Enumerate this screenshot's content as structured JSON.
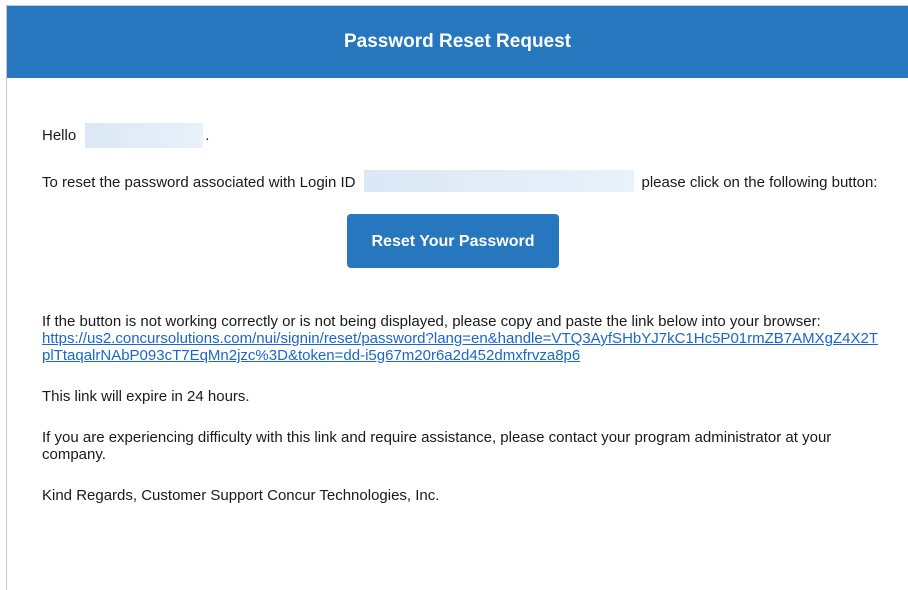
{
  "header": {
    "title": "Password Reset Request"
  },
  "email": {
    "greeting": "Hello",
    "greeting_suffix": ".",
    "reset_prefix": "To reset the password associated with Login ID",
    "reset_suffix": "please click on the following button:",
    "reset_button_label": "Reset Your Password",
    "fallback_text": "If the button is not working correctly or is not being displayed, please copy and paste the link below into your browser:",
    "reset_link": "https://us2.concursolutions.com/nui/signin/reset/password?lang=en&handle=VTQ3AyfSHbYJ7kC1Hc5P01rmZB7AMXgZ4X2TplTtaqalrNAbP093cT7EqMn2jzc%3D&token=dd-i5g67m20r6a2d452dmxfrvza8p6",
    "expiry_text": "This link will expire in 24 hours.",
    "help_text": "If you are experiencing difficulty with this link and require assistance, please contact your program administrator at your company.",
    "signoff": "Kind Regards, Customer Support Concur Technologies, Inc."
  },
  "colors": {
    "brand_blue": "#2777bf",
    "link_blue": "#1a66cc",
    "redaction": "#dbe8f5"
  }
}
